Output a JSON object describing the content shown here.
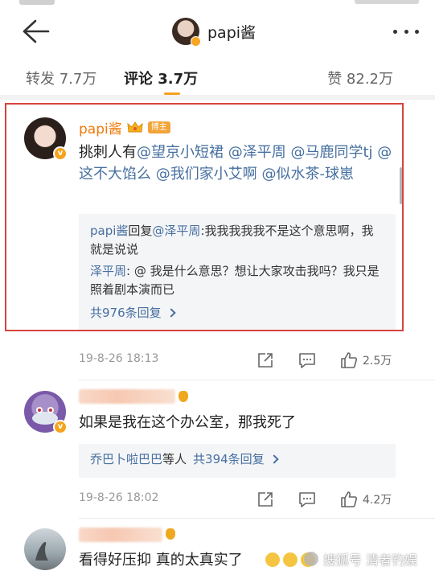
{
  "header": {
    "title": "papi酱"
  },
  "tabs": [
    {
      "label": "转发 7.7万"
    },
    {
      "label": "评论 3.7万"
    },
    {
      "label": "赞 82.2万"
    }
  ],
  "colors": {
    "accent": "#f7a21c",
    "mention": "#466fa0",
    "username": "#f07a0d",
    "highlight": "#d6433d"
  },
  "comments": [
    {
      "username": "papi酱",
      "badge": "博主",
      "text_prefix": "挑刺人有",
      "mentions": [
        "@望京小短裙",
        "@泽平周",
        "@马鹿同学tj",
        "@这不大馅么",
        "@我们家小艾啊",
        "@似水茶-球崽"
      ],
      "replies": [
        {
          "user": "papi酱",
          "verb": "回复",
          "target": "@泽平周",
          "text": ":我我我我我不是这个意思啊，我就是说说"
        },
        {
          "user": "泽平周",
          "text": ": @ 我是什么意思？想让大家攻击我吗？我只是照着剧本演而已"
        }
      ],
      "reply_more": "共976条回复",
      "time": "19-8-26 18:13",
      "likes": "2.5万"
    },
    {
      "text": "如果是我在这个办公室，那我死了",
      "reply_more_user": "乔巴卜啦巴巴",
      "reply_more_suffix": "等人",
      "reply_more_count": "共394条回复",
      "time": "19-8-26 18:02",
      "likes": "4.2万"
    },
    {
      "text": "看得好压抑 真的太真实了"
    }
  ],
  "watermark": "搜狐号 清者钓娱"
}
